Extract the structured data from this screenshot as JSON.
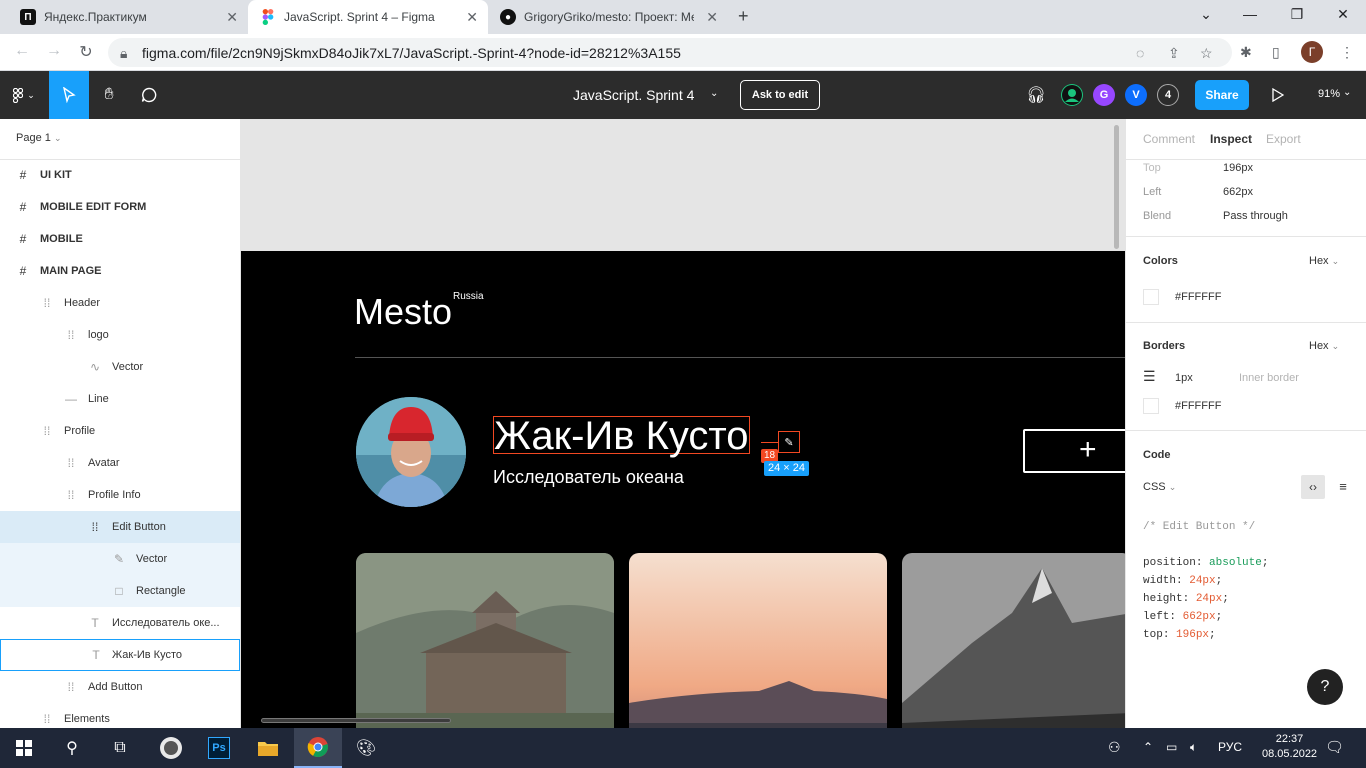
{
  "browser": {
    "tabs": [
      {
        "title": "Яндекс.Практикум",
        "favicon": "praktikum-icon"
      },
      {
        "title": "JavaScript. Sprint 4 – Figma",
        "favicon": "figma-icon"
      },
      {
        "title": "GrigoryGriko/mesto: Проект: Ме",
        "favicon": "github-icon"
      }
    ],
    "url": "figma.com/file/2cn9N9jSkmxD84oJik7xL7/JavaScript.-Sprint-4?node-id=28212%3A155",
    "profile_initial": "Г"
  },
  "figma": {
    "file_title": "JavaScript. Sprint 4",
    "ask_edit_label": "Ask to edit",
    "share_label": "Share",
    "zoom": "91%",
    "collaborators": [
      {
        "initial": "",
        "color": "#1bc47d"
      },
      {
        "initial": "G",
        "color": "#9747ff"
      },
      {
        "initial": "V",
        "color": "#0d6efd"
      },
      {
        "initial": "4",
        "color": "#2c2c2c"
      }
    ]
  },
  "layers": {
    "page_label": "Page 1",
    "items": [
      {
        "label": "UI KIT",
        "icon": "frame-icon"
      },
      {
        "label": "MOBILE EDIT FORM",
        "icon": "frame-icon"
      },
      {
        "label": "MOBILE",
        "icon": "frame-icon"
      },
      {
        "label": "MAIN PAGE",
        "icon": "frame-icon"
      },
      {
        "label": "Header",
        "icon": "group-icon"
      },
      {
        "label": "logo",
        "icon": "group-icon"
      },
      {
        "label": "Vector",
        "icon": "vector-icon"
      },
      {
        "label": "Line",
        "icon": "line-icon"
      },
      {
        "label": "Profile",
        "icon": "group-icon"
      },
      {
        "label": "Avatar",
        "icon": "group-icon"
      },
      {
        "label": "Profile Info",
        "icon": "group-icon"
      },
      {
        "label": "Edit Button",
        "icon": "group-icon"
      },
      {
        "label": "Vector",
        "icon": "pen-icon"
      },
      {
        "label": "Rectangle",
        "icon": "rectangle-icon"
      },
      {
        "label": "Исследователь оке...",
        "icon": "text-icon"
      },
      {
        "label": "Жак-Ив Кусто",
        "icon": "text-icon"
      },
      {
        "label": "Add Button",
        "icon": "group-icon"
      },
      {
        "label": "Elements",
        "icon": "group-icon"
      }
    ]
  },
  "canvas": {
    "logo": "Mesto",
    "logo_sup": "Russia",
    "profile_name": "Жак-Ив Кусто",
    "profile_about": "Исследователь океана",
    "distance_label": "18",
    "size_label": "24 × 24",
    "add_button_glyph": "+"
  },
  "inspect": {
    "tabs": [
      "Comment",
      "Inspect",
      "Export"
    ],
    "props": [
      {
        "key": "Top",
        "value": "196px"
      },
      {
        "key": "Left",
        "value": "662px"
      },
      {
        "key": "Blend",
        "value": "Pass through"
      }
    ],
    "colors_title": "Colors",
    "colors_format": "Hex",
    "color_value": "#FFFFFF",
    "borders_title": "Borders",
    "borders_format": "Hex",
    "border_width": "1px",
    "border_type": "Inner border",
    "border_color": "#FFFFFF",
    "code_title": "Code",
    "code_lang": "CSS",
    "code_comment": "/* Edit Button */",
    "code_lines": [
      {
        "prop": "position",
        "value": "absolute"
      },
      {
        "prop": "width",
        "value": "24px"
      },
      {
        "prop": "height",
        "value": "24px"
      },
      {
        "prop": "left",
        "value": "662px"
      },
      {
        "prop": "top",
        "value": "196px"
      }
    ],
    "help_glyph": "?"
  },
  "taskbar": {
    "lang": "РУС",
    "time": "22:37",
    "date": "08.05.2022"
  }
}
